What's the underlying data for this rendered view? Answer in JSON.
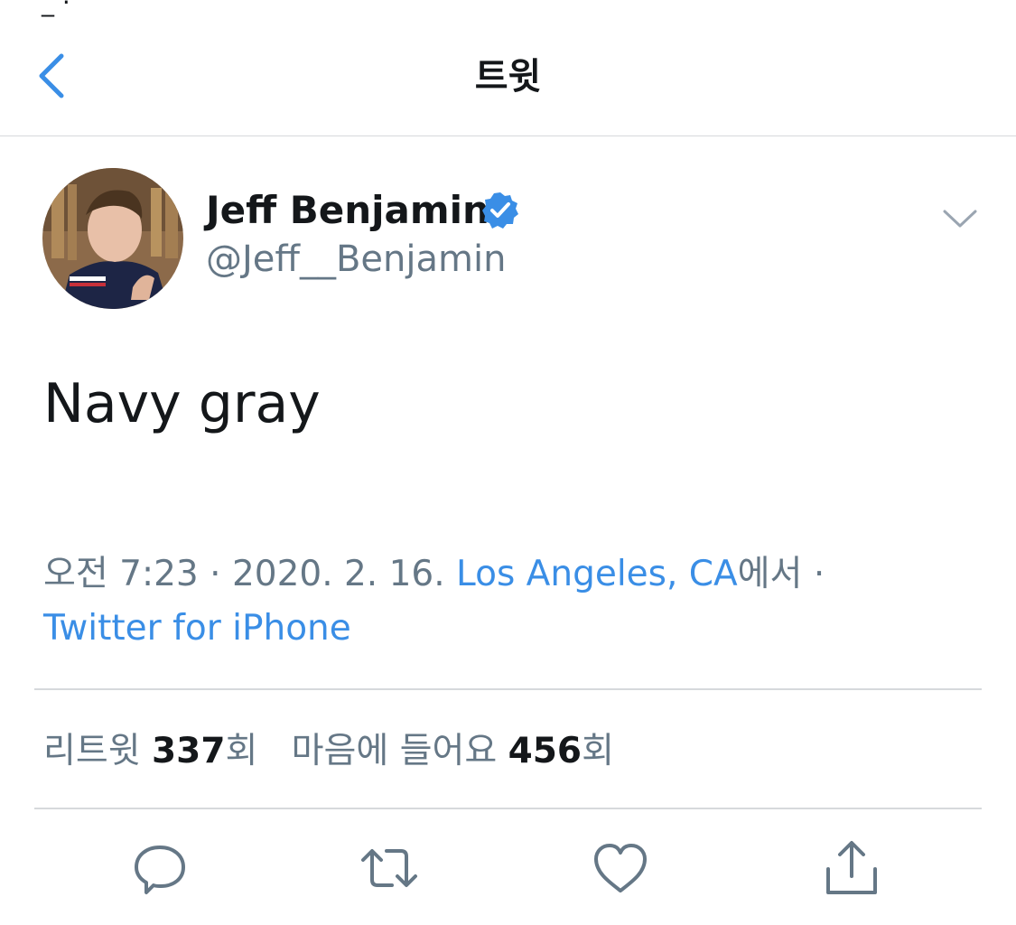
{
  "status_bar": {
    "remnant": "_ ·"
  },
  "header": {
    "title": "트윗"
  },
  "tweet": {
    "author": {
      "name": "Jeff Benjamin",
      "handle": "@Jeff__Benjamin",
      "verified": true
    },
    "text": "Navy gray",
    "meta": {
      "time": "오전 7:23",
      "separator": " · ",
      "date": "2020. 2. 16.",
      "location": "Los Angeles, CA",
      "location_suffix": "에서",
      "source": "Twitter for iPhone"
    },
    "stats": {
      "retweets_label": "리트윗",
      "retweets_count": "337",
      "retweets_suffix": "회",
      "likes_label": "마음에 들어요",
      "likes_count": "456",
      "likes_suffix": "회"
    }
  },
  "icons": {
    "back": "chevron-left-icon",
    "verified": "verified-badge-icon",
    "more": "chevron-down-icon",
    "reply": "comment-icon",
    "retweet": "retweet-icon",
    "like": "heart-icon",
    "share": "share-icon"
  },
  "colors": {
    "accent": "#3a8ee6",
    "text_primary": "#14171a",
    "text_secondary": "#657786",
    "icon_gray": "#657786",
    "divider": "#d6d9dc"
  }
}
